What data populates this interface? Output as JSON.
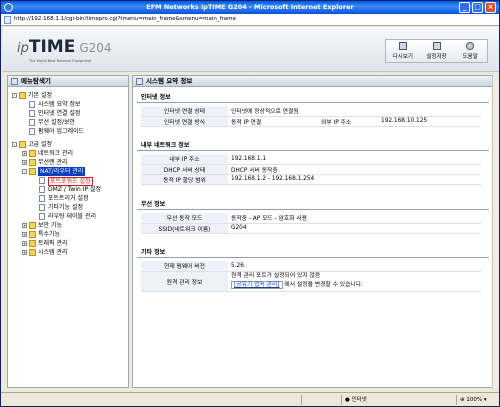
{
  "window": {
    "title": "EFM Networks ipTIME G204 - Microsoft Internet Explorer"
  },
  "address": {
    "url": "http://192.168.1.1/cgi-bin/timepro.cgi?tmenu=main_frame&smenu=main_frame"
  },
  "header": {
    "logo_ip": "ip",
    "logo_time": "TIME",
    "logo_model": "G204",
    "logo_sub": "The World Best Network Equipment",
    "buttons": [
      {
        "label": "다시보기",
        "icon": "refresh-icon"
      },
      {
        "label": "설정저장",
        "icon": "save-icon"
      },
      {
        "label": "도움말",
        "icon": "help-icon"
      }
    ]
  },
  "sidebar": {
    "title": "메뉴탐색기",
    "items": [
      {
        "label": "기본 설정",
        "level": 0,
        "kind": "folder",
        "toggle": "-"
      },
      {
        "label": "시스템 요약 정보",
        "level": 1,
        "kind": "page"
      },
      {
        "label": "인터넷 연결 설정",
        "level": 1,
        "kind": "page"
      },
      {
        "label": "무선 설정/보안",
        "level": 1,
        "kind": "page"
      },
      {
        "label": "펌웨어 업그레이드",
        "level": 1,
        "kind": "page"
      },
      {
        "label": "",
        "level": 0,
        "kind": "spacer"
      },
      {
        "label": "고급 설정",
        "level": 0,
        "kind": "folder",
        "toggle": "-"
      },
      {
        "label": "네트워크 관리",
        "level": 1,
        "kind": "folder",
        "toggle": "+"
      },
      {
        "label": "무선랜 관리",
        "level": 1,
        "kind": "folder",
        "toggle": "+"
      },
      {
        "label": "NAT/라우터 관리",
        "level": 1,
        "kind": "folder",
        "toggle": "-",
        "state": "selected"
      },
      {
        "label": "포트포워드 설정",
        "level": 2,
        "kind": "page",
        "state": "focused"
      },
      {
        "label": "DMZ / Twin IP 설정",
        "level": 2,
        "kind": "page"
      },
      {
        "label": "포트트리거 설정",
        "level": 2,
        "kind": "page"
      },
      {
        "label": "기타기능 설정",
        "level": 2,
        "kind": "page"
      },
      {
        "label": "라우팅 테이블 관리",
        "level": 2,
        "kind": "page"
      },
      {
        "label": "보안 기능",
        "level": 1,
        "kind": "folder",
        "toggle": "+"
      },
      {
        "label": "특수기능",
        "level": 1,
        "kind": "folder",
        "toggle": "+"
      },
      {
        "label": "트래픽 관리",
        "level": 1,
        "kind": "folder",
        "toggle": "+"
      },
      {
        "label": "시스템 관리",
        "level": 1,
        "kind": "folder",
        "toggle": "+"
      }
    ]
  },
  "main": {
    "title": "시스템 요약 정보",
    "sections": [
      {
        "title": "인터넷 정보",
        "rows": [
          {
            "key": "인터넷 연결 상태",
            "value": "인터넷에 정상적으로 연결됨"
          },
          {
            "key": "인터넷 연결 방식",
            "value": "동적 IP 연결",
            "key2": "외부 IP 주소",
            "value2": "192.168.10.125"
          }
        ]
      },
      {
        "title": "내부 네트워크 정보",
        "rows": [
          {
            "key": "내부 IP 주소",
            "value": "192.168.1.1"
          },
          {
            "key": "DHCP 서버 상태",
            "value": "DHCP 서버 동작중"
          },
          {
            "key": "동적 IP 할당 범위",
            "value": "192.168.1.2 - 192.168.1.254"
          }
        ]
      },
      {
        "title": "무선 정보",
        "rows": [
          {
            "key": "무선 동작 모드",
            "value": "동작중 - AP 모드 - 암호화 사용"
          },
          {
            "key": "SSID(네트워크 이름)",
            "value": "G204"
          }
        ]
      },
      {
        "title": "기타 정보",
        "rows": [
          {
            "key": "현재 펌웨어 버전",
            "value": "5.26"
          },
          {
            "key": "원격 관리 정보",
            "value": "원격 관리 포트가 설정되어 있지 않음",
            "link": "[공유기 접속 관리]",
            "value_after": " 에서 설정을 변경할 수 있습니다."
          }
        ]
      }
    ]
  },
  "status": {
    "zone": "인터넷",
    "zoom": "100%"
  }
}
